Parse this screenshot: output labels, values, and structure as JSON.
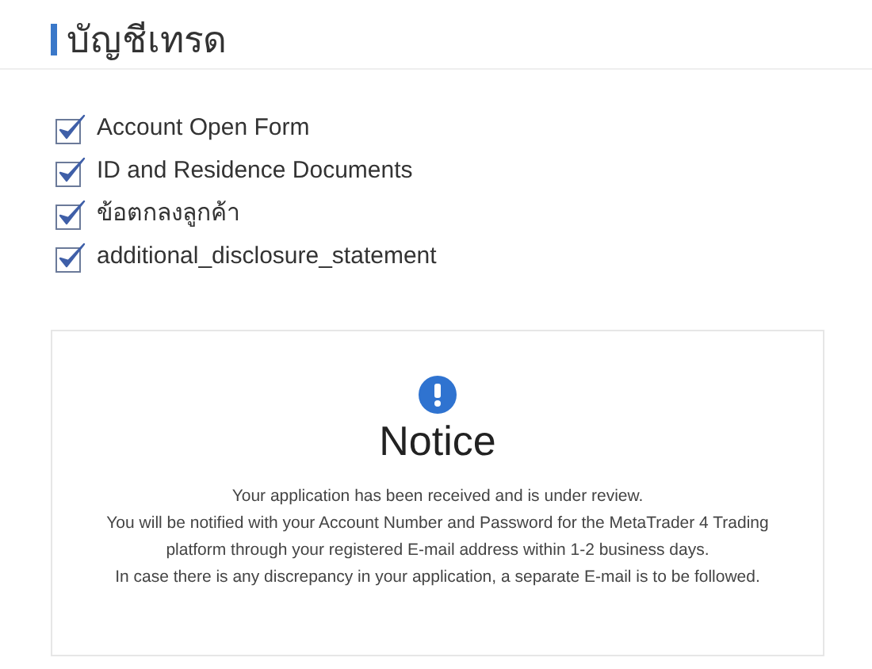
{
  "title": "บัญชีเทรด",
  "documents": [
    {
      "label": "Account Open Form",
      "checked": true
    },
    {
      "label": "ID and Residence Documents",
      "checked": true
    },
    {
      "label": "ข้อตกลงลูกค้า",
      "checked": true
    },
    {
      "label": "additional_disclosure_statement",
      "checked": true
    }
  ],
  "notice": {
    "title": "Notice",
    "sentences": [
      "Your application has been received and is under review.",
      "You will be notified with your Account Number and Password for the MetaTrader 4 Trading platform through your registered E-mail address within 1-2 business days.",
      "In case there is any discrepancy in your application, a separate E-mail is to be followed."
    ]
  }
}
